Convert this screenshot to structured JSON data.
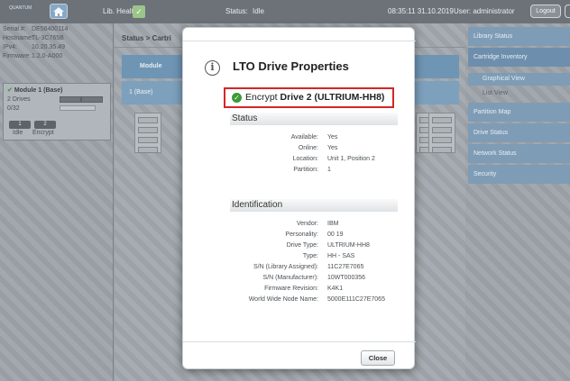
{
  "topbar": {
    "logo_text": "QUANTUM",
    "lib_health_label": "Lib. Health:",
    "status_label": "Status:",
    "status_value": "Idle",
    "datetime": "08:35:11  31.10.2019",
    "user_label": "User: administrator",
    "logout_label": "Logout"
  },
  "left": {
    "serial_label": "Serial #:",
    "serial_value": "DE56400114",
    "hostname_label": "Hostname:",
    "hostname_value": "TL-3C765B",
    "ipv4_label": "IPv4:",
    "ipv4_value": "10.20.35.49",
    "firmware_label": "Firmware:",
    "firmware_value": "1.2.0-A000",
    "module_title": "Module 1 (Base)",
    "drives_label": "2 Drives",
    "slots_label": "0/32",
    "chip1": "1",
    "chip2": "2",
    "chip1_label": "Idle",
    "chip2_label": "Encrypt"
  },
  "center": {
    "breadcrumb": "Status > Cartri",
    "table_header": "Module",
    "table_row": "1 (Base)"
  },
  "nav": {
    "items": [
      "Library Status",
      "Cartridge Inventory",
      "Graphical View",
      "List View",
      "Partition Map",
      "Drive Status",
      "Network Status",
      "Security"
    ]
  },
  "modal": {
    "title": "LTO Drive Properties",
    "encrypt_prefix": "Encrypt",
    "encrypt_bold": "Drive 2 (ULTRIUM-HH8)",
    "status_section": "Status",
    "status_rows": [
      {
        "k": "Available:",
        "v": "Yes"
      },
      {
        "k": "Online:",
        "v": "Yes"
      },
      {
        "k": "Location:",
        "v": "Unit 1, Position 2"
      },
      {
        "k": "Partition:",
        "v": "1"
      }
    ],
    "ident_section": "Identification",
    "ident_rows": [
      {
        "k": "Vendor:",
        "v": "IBM"
      },
      {
        "k": "Personality:",
        "v": "00 19"
      },
      {
        "k": "Drive Type:",
        "v": "ULTRIUM-HH8"
      },
      {
        "k": "Type:",
        "v": "HH - SAS"
      },
      {
        "k": "S/N (Library Assigned):",
        "v": "11C27E7065"
      },
      {
        "k": "S/N (Manufacturer):",
        "v": "10WT000356"
      },
      {
        "k": "Firmware Revision:",
        "v": "K4K1"
      },
      {
        "k": "World Wide Node Name:",
        "v": "5000E111C27E7065"
      }
    ],
    "close_label": "Close"
  },
  "colors": {
    "highlight_border": "#d52626",
    "ok_green": "#3c9a36",
    "nav_blue": "#7e9cb6"
  }
}
